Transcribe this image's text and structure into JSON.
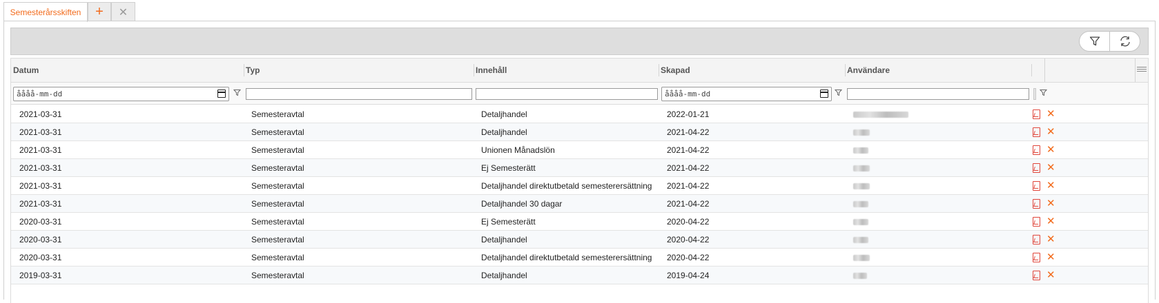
{
  "tabs": {
    "active_label": "Semesterårsskiften",
    "add_label": "+",
    "close_label": "✕"
  },
  "toolbar": {
    "filter_icon": "filter-icon",
    "refresh_icon": "refresh-icon"
  },
  "columns": {
    "datum": "Datum",
    "typ": "Typ",
    "innehall": "Innehåll",
    "skapad": "Skapad",
    "anvandare": "Användare"
  },
  "filters": {
    "datum_placeholder": "åååå-mm-dd",
    "skapad_placeholder": "åååå-mm-dd"
  },
  "rows": [
    {
      "datum": "2021-03-31",
      "typ": "Semesteravtal",
      "innehall": "Detaljhandel",
      "skapad": "2022-01-21"
    },
    {
      "datum": "2021-03-31",
      "typ": "Semesteravtal",
      "innehall": "Detaljhandel",
      "skapad": "2021-04-22"
    },
    {
      "datum": "2021-03-31",
      "typ": "Semesteravtal",
      "innehall": "Unionen Månadslön",
      "skapad": "2021-04-22"
    },
    {
      "datum": "2021-03-31",
      "typ": "Semesteravtal",
      "innehall": "Ej Semesterätt",
      "skapad": "2021-04-22"
    },
    {
      "datum": "2021-03-31",
      "typ": "Semesteravtal",
      "innehall": "Detaljhandel direktutbetald semesterersättning",
      "skapad": "2021-04-22"
    },
    {
      "datum": "2021-03-31",
      "typ": "Semesteravtal",
      "innehall": "Detaljhandel 30 dagar",
      "skapad": "2021-04-22"
    },
    {
      "datum": "2020-03-31",
      "typ": "Semesteravtal",
      "innehall": "Ej Semesterätt",
      "skapad": "2020-04-22"
    },
    {
      "datum": "2020-03-31",
      "typ": "Semesteravtal",
      "innehall": "Detaljhandel",
      "skapad": "2020-04-22"
    },
    {
      "datum": "2020-03-31",
      "typ": "Semesteravtal",
      "innehall": "Detaljhandel direktutbetald semesterersättning",
      "skapad": "2020-04-22"
    },
    {
      "datum": "2019-03-31",
      "typ": "Semesteravtal",
      "innehall": "Detaljhandel",
      "skapad": "2019-04-24"
    }
  ],
  "colors": {
    "accent": "#f26a1b",
    "pdf_icon": "#e0453a",
    "toolbar_bg": "#dedede"
  }
}
